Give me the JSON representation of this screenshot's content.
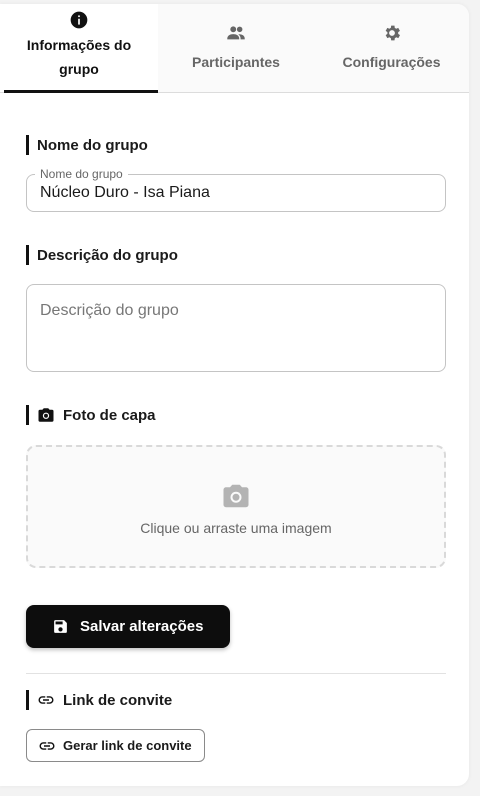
{
  "tabs": [
    {
      "label_line1": "Informações do",
      "label_line2": "grupo",
      "icon": "info-icon",
      "active": true
    },
    {
      "label": "Participantes",
      "icon": "people-icon",
      "active": false
    },
    {
      "label": "Configurações",
      "icon": "gear-icon",
      "active": false
    }
  ],
  "sections": {
    "name": {
      "title": "Nome do grupo",
      "field_label": "Nome do grupo",
      "value": "Núcleo Duro - Isa Piana"
    },
    "description": {
      "title": "Descrição do grupo",
      "placeholder": "Descrição do grupo"
    },
    "cover": {
      "title": "Foto de capa",
      "icon": "camera-icon",
      "dropzone_text": "Clique ou arraste uma imagem"
    },
    "invite": {
      "title": "Link de convite",
      "icon": "link-icon",
      "button_label": "Gerar link de convite"
    }
  },
  "actions": {
    "save_label": "Salvar alterações",
    "save_icon": "save-icon"
  },
  "colors": {
    "accent": "#0d0d0d",
    "muted_text": "#666666",
    "border": "#c4c4c4"
  }
}
